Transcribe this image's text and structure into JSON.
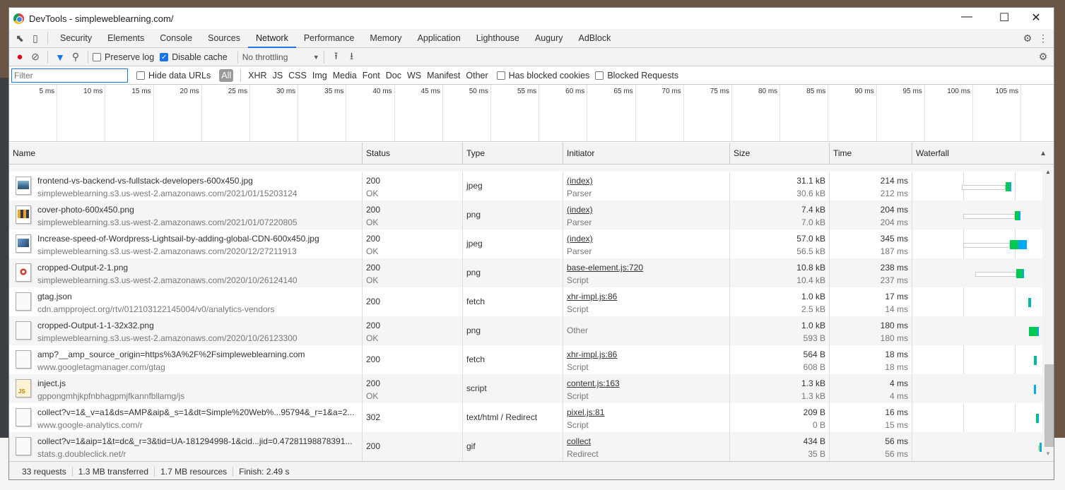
{
  "window": {
    "title": "DevTools - simpleweblearning.com/",
    "minimize": "—",
    "maximize": "☐",
    "close": "✕"
  },
  "tabs": [
    {
      "label": "Security"
    },
    {
      "label": "Elements"
    },
    {
      "label": "Console"
    },
    {
      "label": "Sources"
    },
    {
      "label": "Network",
      "active": true
    },
    {
      "label": "Performance"
    },
    {
      "label": "Memory"
    },
    {
      "label": "Application"
    },
    {
      "label": "Lighthouse"
    },
    {
      "label": "Augury"
    },
    {
      "label": "AdBlock"
    }
  ],
  "toolbar": {
    "preserve_log": "Preserve log",
    "preserve_log_checked": false,
    "disable_cache": "Disable cache",
    "disable_cache_checked": true,
    "throttling": "No throttling"
  },
  "filterbar": {
    "placeholder": "Filter",
    "hide_data_urls": "Hide data URLs",
    "types": [
      "All",
      "XHR",
      "JS",
      "CSS",
      "Img",
      "Media",
      "Font",
      "Doc",
      "WS",
      "Manifest",
      "Other"
    ],
    "has_blocked_cookies": "Has blocked cookies",
    "blocked_requests": "Blocked Requests"
  },
  "overview": {
    "ticks": [
      "5 ms",
      "10 ms",
      "15 ms",
      "20 ms",
      "25 ms",
      "30 ms",
      "35 ms",
      "40 ms",
      "45 ms",
      "50 ms",
      "55 ms",
      "60 ms",
      "65 ms",
      "70 ms",
      "75 ms",
      "80 ms",
      "85 ms",
      "90 ms",
      "95 ms",
      "100 ms",
      "105 ms",
      "11"
    ]
  },
  "columns": {
    "name": "Name",
    "status": "Status",
    "type": "Type",
    "initiator": "Initiator",
    "size": "Size",
    "time": "Time",
    "waterfall": "Waterfall"
  },
  "colors": {
    "waiting": "#00c853",
    "download": "#03a9f4",
    "accent": "#1a73e8",
    "record": "#e0001b"
  },
  "rows": [
    {
      "name": "frontend-vs-backend-vs-fullstack-developers-600x450.jpg",
      "path": "simpleweblearning.s3.us-west-2.amazonaws.com/2021/01/15203124",
      "status": "200",
      "status_text": "OK",
      "type": "jpeg",
      "initiator": "(index)",
      "initiator_sub": "Parser",
      "size": "31.1 kB",
      "size_sub": "30.6 kB",
      "time": "214 ms",
      "time_sub": "212 ms",
      "icon": "image-thumb-sky"
    },
    {
      "name": "cover-photo-600x450.png",
      "path": "simpleweblearning.s3.us-west-2.amazonaws.com/2021/01/07220805",
      "status": "200",
      "status_text": "OK",
      "type": "png",
      "initiator": "(index)",
      "initiator_sub": "Parser",
      "size": "7.4 kB",
      "size_sub": "7.0 kB",
      "time": "204 ms",
      "time_sub": "204 ms",
      "icon": "image-thumb-cover"
    },
    {
      "name": "Increase-speed-of-Wordpress-Lightsail-by-adding-global-CDN-600x450.jpg",
      "path": "simpleweblearning.s3.us-west-2.amazonaws.com/2020/12/27211913",
      "status": "200",
      "status_text": "OK",
      "type": "jpeg",
      "initiator": "(index)",
      "initiator_sub": "Parser",
      "size": "57.0 kB",
      "size_sub": "56.5 kB",
      "time": "345 ms",
      "time_sub": "187 ms",
      "icon": "image-thumb-cdn"
    },
    {
      "name": "cropped-Output-2-1.png",
      "path": "simpleweblearning.s3.us-west-2.amazonaws.com/2020/10/26124140",
      "status": "200",
      "status_text": "OK",
      "type": "png",
      "initiator": "base-element.js:720",
      "initiator_sub": "Script",
      "size": "10.8 kB",
      "size_sub": "10.4 kB",
      "time": "238 ms",
      "time_sub": "237 ms",
      "icon": "image-thumb-output"
    },
    {
      "name": "gtag.json",
      "path": "cdn.ampproject.org/rtv/012103122145004/v0/analytics-vendors",
      "status": "200",
      "status_text": "",
      "type": "fetch",
      "initiator": "xhr-impl.js:86",
      "initiator_sub": "Script",
      "size": "1.0 kB",
      "size_sub": "2.5 kB",
      "time": "17 ms",
      "time_sub": "14 ms",
      "icon": "document-icon"
    },
    {
      "name": "cropped-Output-1-1-32x32.png",
      "path": "simpleweblearning.s3.us-west-2.amazonaws.com/2020/10/26123300",
      "status": "200",
      "status_text": "OK",
      "type": "png",
      "initiator": "",
      "initiator_sub": "Other",
      "size": "1.0 kB",
      "size_sub": "593 B",
      "time": "180 ms",
      "time_sub": "180 ms",
      "icon": "document-icon"
    },
    {
      "name": "amp?__amp_source_origin=https%3A%2F%2Fsimpleweblearning.com",
      "path": "www.googletagmanager.com/gtag",
      "status": "200",
      "status_text": "",
      "type": "fetch",
      "initiator": "xhr-impl.js:86",
      "initiator_sub": "Script",
      "size": "564 B",
      "size_sub": "608 B",
      "time": "18 ms",
      "time_sub": "18 ms",
      "icon": "document-icon"
    },
    {
      "name": "inject.js",
      "path": "gppongmhjkpfnbhagpmjfkannfbllamg/js",
      "status": "200",
      "status_text": "OK",
      "type": "script",
      "initiator": "content.js:163",
      "initiator_sub": "Script",
      "size": "1.3 kB",
      "size_sub": "1.3 kB",
      "time": "4 ms",
      "time_sub": "4 ms",
      "icon": "js-file-icon"
    },
    {
      "name": "collect?v=1&_v=a1&ds=AMP&aip&_s=1&dt=Simple%20Web%...95794&_r=1&a=2...",
      "path": "www.google-analytics.com/r",
      "status": "302",
      "status_text": "",
      "type": "text/html / Redirect",
      "initiator": "pixel.js:81",
      "initiator_sub": "Script",
      "size": "209 B",
      "size_sub": "0 B",
      "time": "16 ms",
      "time_sub": "15 ms",
      "icon": "broken-image-icon"
    },
    {
      "name": "collect?v=1&aip=1&t=dc&_r=3&tid=UA-181294998-1&cid...jid=0.47281198878391...",
      "path": "stats.g.doubleclick.net/r",
      "status": "200",
      "status_text": "",
      "type": "gif",
      "initiator": "collect",
      "initiator_sub": "Redirect",
      "size": "434 B",
      "size_sub": "35 B",
      "time": "56 ms",
      "time_sub": "56 ms",
      "icon": "document-icon"
    }
  ],
  "footer": {
    "requests": "33 requests",
    "transferred": "1.3 MB transferred",
    "resources": "1.7 MB resources",
    "finish": "Finish: 2.49 s"
  }
}
